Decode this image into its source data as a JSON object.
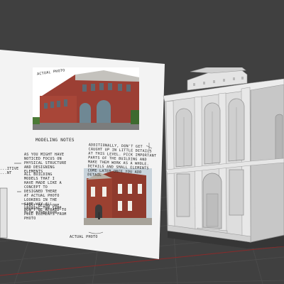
{
  "viewport": {
    "background": "#404040",
    "grid_color": "#4b4b4b",
    "axis_x_color": "#8a2a2a"
  },
  "reference_sheet": {
    "photo_top_label": "Actual Photo",
    "modeling_notes_title": "Modeling Notes",
    "note_left": "As you might have noticed focus on physical structure and designing elements",
    "note_left_2": "All building models that I have made like a concept to designed there at actual photo lookers in the same way all showing the same flow direction",
    "note_left_3": "First being one, don't be afraid to pull elements from photo",
    "note_right": "Additionally, don't get caught up in little details at this level. Pick important parts of the building and make them work as a whole. Details and small elements come later once you add detail",
    "note_left_edge": "...itive ...nt",
    "photo_bottom_label": "Actual Photo"
  }
}
